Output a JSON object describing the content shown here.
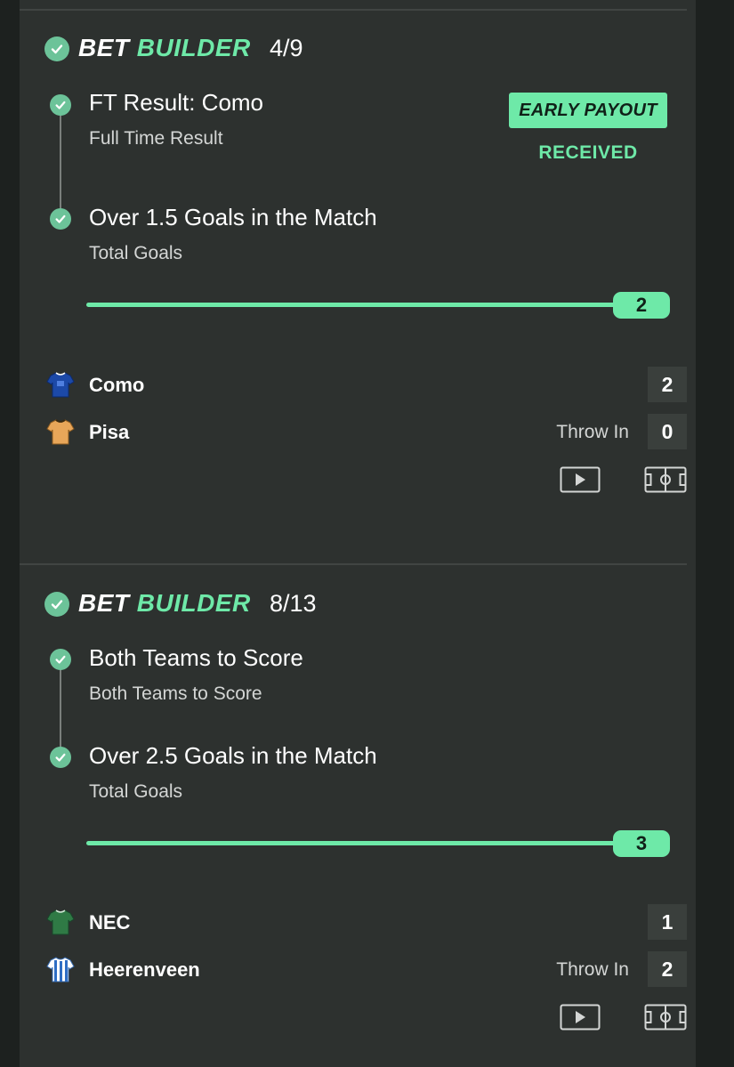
{
  "bets": [
    {
      "header": {
        "word1": "BET",
        "word2": "BUILDER",
        "count": "4/9"
      },
      "legs": [
        {
          "title": "FT Result: Como",
          "subtitle": "Full Time Result"
        },
        {
          "title": "Over 1.5 Goals in the Match",
          "subtitle": "Total Goals"
        }
      ],
      "badge": "EARLY PAYOUT",
      "badge_status": "RECEIVED",
      "progress": {
        "value": "2",
        "fraction": 1.0
      },
      "teams": [
        {
          "name": "Como",
          "score": "2",
          "shirt": "blue-shirt-icon"
        },
        {
          "name": "Pisa",
          "score": "0",
          "shirt": "orange-shirt-icon"
        }
      ],
      "match_status": "Throw In"
    },
    {
      "header": {
        "word1": "BET",
        "word2": "BUILDER",
        "count": "8/13"
      },
      "legs": [
        {
          "title": "Both Teams to Score",
          "subtitle": "Both Teams to Score"
        },
        {
          "title": "Over 2.5 Goals in the Match",
          "subtitle": "Total Goals"
        }
      ],
      "progress": {
        "value": "3",
        "fraction": 1.0
      },
      "teams": [
        {
          "name": "NEC",
          "score": "1",
          "shirt": "green-shirt-icon"
        },
        {
          "name": "Heerenveen",
          "score": "2",
          "shirt": "striped-shirt-icon"
        }
      ],
      "match_status": "Throw In"
    }
  ],
  "colors": {
    "accent": "#6ee9a8",
    "check": "#6cc399",
    "panel": "#2d312f",
    "background": "#1d211f"
  },
  "icons": [
    "check-icon",
    "play-icon",
    "pitch-icon"
  ]
}
